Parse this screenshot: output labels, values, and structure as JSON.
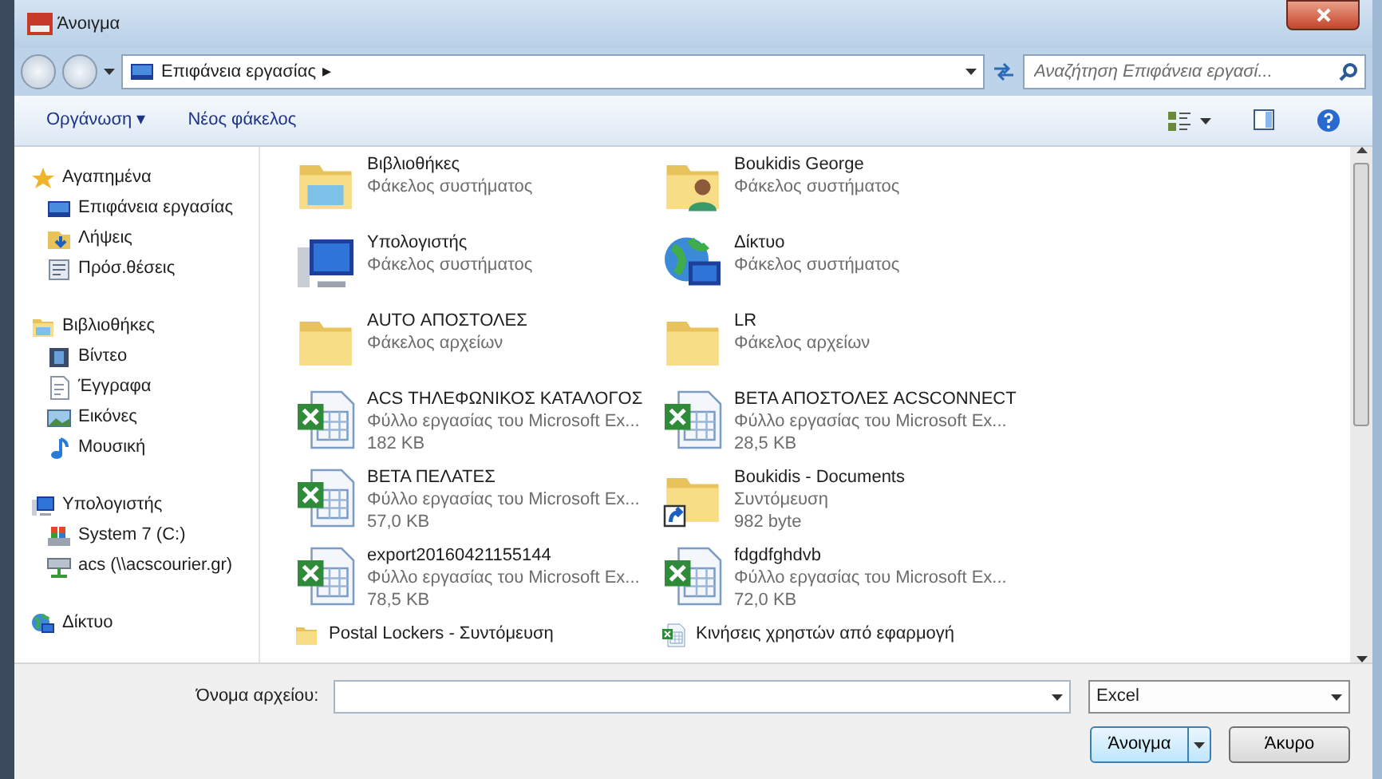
{
  "window": {
    "title": "Άνοιγμα"
  },
  "address_bar": {
    "location": "Επιφάνεια εργασίας",
    "separator": "▸",
    "search": {
      "placeholder": "Αναζήτηση Επιφάνεια εργασί..."
    }
  },
  "toolbar": {
    "organize": "Οργάνωση ▾",
    "new_folder": "Νέος φάκελος"
  },
  "sidebar": {
    "groups": [
      {
        "label": "Αγαπημένα",
        "kind": "star",
        "children": [
          {
            "label": "Επιφάνεια εργασίας",
            "kind": "desktop"
          },
          {
            "label": "Λήψεις",
            "kind": "downloads"
          },
          {
            "label": "Πρόσ.θέσεις",
            "kind": "places"
          }
        ]
      },
      {
        "label": "Βιβλιοθήκες",
        "kind": "libraries",
        "children": [
          {
            "label": "Βίντεο",
            "kind": "video"
          },
          {
            "label": "Έγγραφα",
            "kind": "document"
          },
          {
            "label": "Εικόνες",
            "kind": "pictures"
          },
          {
            "label": "Μουσική",
            "kind": "music"
          }
        ]
      },
      {
        "label": "Υπολογιστής",
        "kind": "computer",
        "children": [
          {
            "label": "System 7 (C:)",
            "kind": "drive"
          },
          {
            "label": "acs (\\\\acscourier.gr)",
            "kind": "netdrive"
          }
        ]
      },
      {
        "label": "Δίκτυο",
        "kind": "network"
      }
    ]
  },
  "files": [
    {
      "name": "Βιβλιοθήκες",
      "kind": "libraries",
      "details": [
        "Φάκελος συστήματος"
      ],
      "selected": false
    },
    {
      "name": "Boukidis George",
      "kind": "user",
      "details": [
        "Φάκελος συστήματος"
      ],
      "selected": false
    },
    {
      "name": "Υπολογιστής",
      "kind": "computer",
      "details": [
        "Φάκελος συστήματος"
      ],
      "selected": false
    },
    {
      "name": "Δίκτυο",
      "kind": "network",
      "details": [
        "Φάκελος συστήματος"
      ],
      "selected": false
    },
    {
      "name": "AUTO ΑΠΟΣΤΟΛΕΣ",
      "kind": "folder",
      "details": [
        "Φάκελος αρχείων"
      ],
      "selected": false
    },
    {
      "name": "LR",
      "kind": "folder",
      "details": [
        "Φάκελος αρχείων"
      ],
      "selected": false
    },
    {
      "name": "ACS ΤΗΛΕΦΩΝΙΚΟΣ ΚΑΤΑΛΟΓΟΣ",
      "kind": "excel",
      "details": [
        "Φύλλο εργασίας του Microsoft Ex...",
        "182 KB"
      ],
      "selected": false
    },
    {
      "name": "ΒΕΤΑ ΑΠΟΣΤΟΛΕΣ ACSCONNECT",
      "kind": "excel",
      "details": [
        "Φύλλο εργασίας του Microsoft Ex...",
        "28,5 KB"
      ],
      "selected": false
    },
    {
      "name": "ΒΕΤΑ ΠΕΛΑΤΕΣ",
      "kind": "excel",
      "details": [
        "Φύλλο εργασίας του Microsoft Ex...",
        "57,0 KB"
      ],
      "selected": false
    },
    {
      "name": "Boukidis - Documents",
      "kind": "shortcut",
      "details": [
        "Συντόμευση",
        "982 byte"
      ],
      "selected": false
    },
    {
      "name": "export20160421155144",
      "kind": "excel",
      "details": [
        "Φύλλο εργασίας του Microsoft Ex...",
        "78,5 KB"
      ],
      "selected": false
    },
    {
      "name": "fdgdfghdvb",
      "kind": "excel",
      "details": [
        "Φύλλο εργασίας του Microsoft Ex...",
        "72,0 KB"
      ],
      "selected": false
    },
    {
      "name": "Postal Lockers - Συντόμευση",
      "kind": "folder",
      "selected": false
    },
    {
      "name": "Κινήσεις χρηστών από εφαρμογή",
      "kind": "excel",
      "selected": false
    }
  ],
  "footer": {
    "filename_label": "Όνομα αρχείου:",
    "file_type": "Excel",
    "open_button": "Άνοιγμα",
    "cancel_button": "Άκυρο"
  }
}
